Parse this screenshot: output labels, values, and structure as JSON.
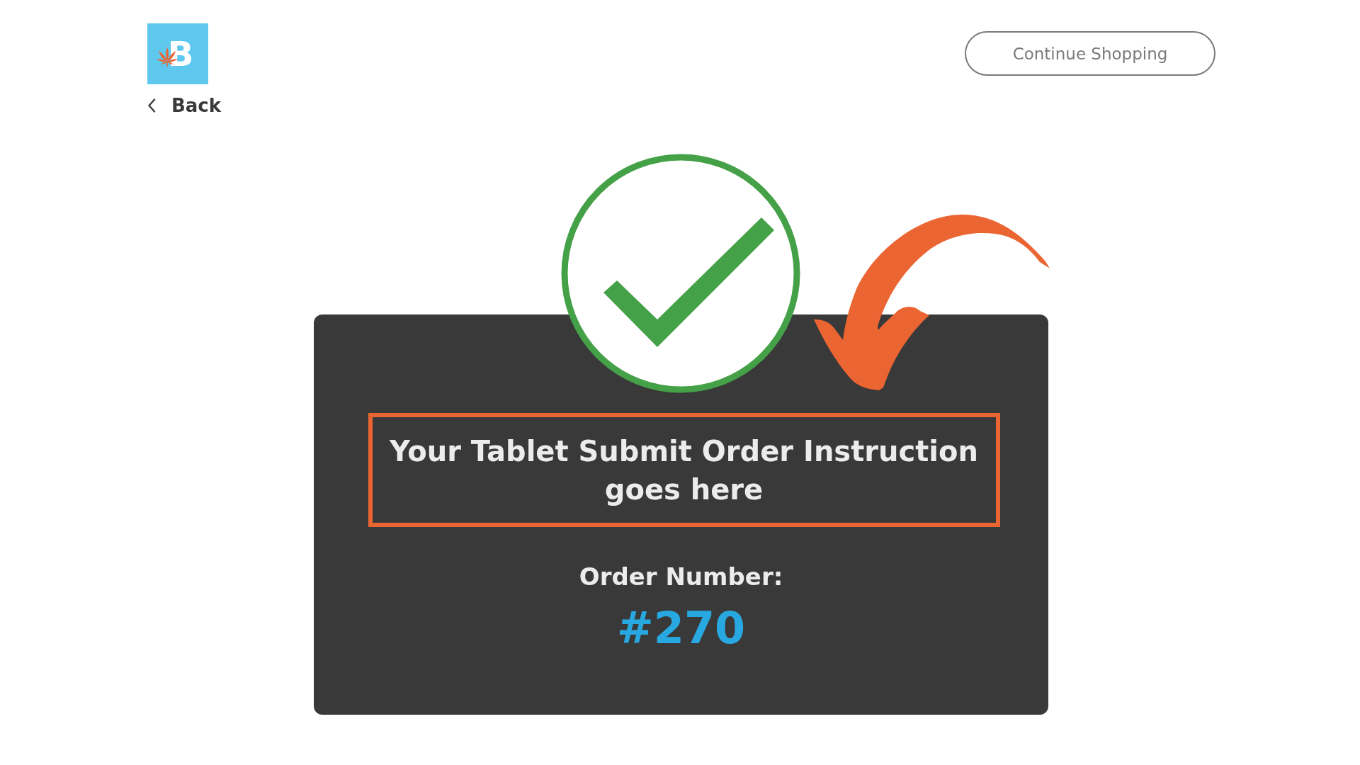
{
  "header": {
    "logo": {
      "letter": "B"
    },
    "back": {
      "label": "Back"
    },
    "continue_button": {
      "label": "Continue Shopping"
    }
  },
  "confirmation": {
    "instruction": "Your Tablet Submit Order Instruction goes here",
    "order_label": "Order Number:",
    "order_number": "#270"
  }
}
